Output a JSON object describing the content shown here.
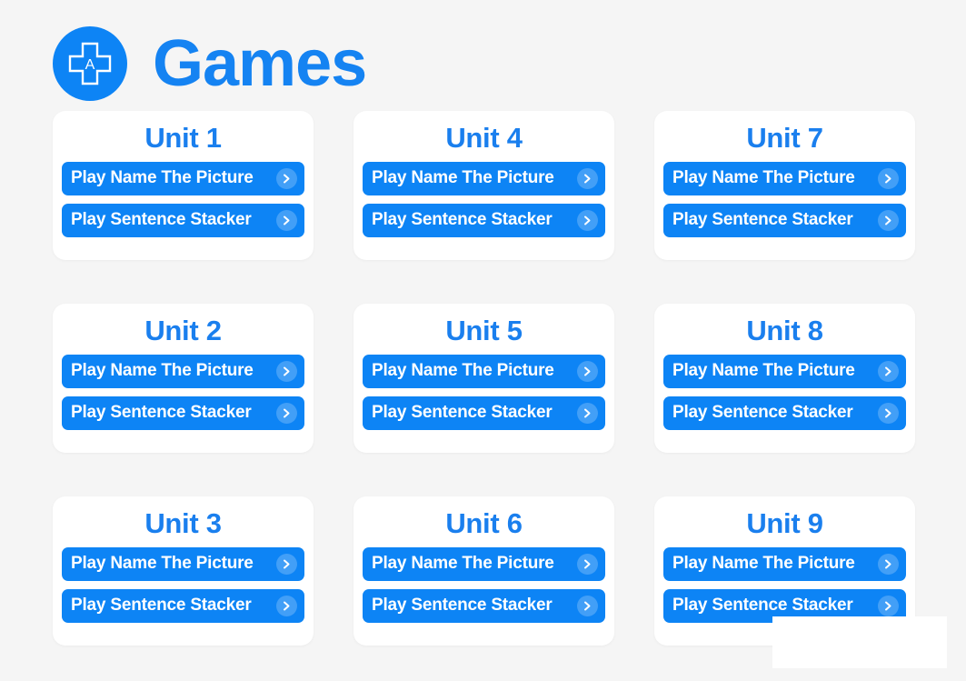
{
  "header": {
    "title": "Games",
    "icon": "dpad-a-icon",
    "icon_letter": "A",
    "accent_color": "#1583f2",
    "icon_bg_color": "#0d84f5"
  },
  "theme": {
    "page_background": "#f5f5f5",
    "card_background": "#ffffff",
    "button_blue": "#0d84f5",
    "unit_title_blue": "#1a7fee",
    "button_text": "#ffffff"
  },
  "main": {
    "buttons": {
      "name_the_picture": "Play Name The Picture",
      "sentence_stacker": "Play Sentence Stacker",
      "chevron_icon": "chevron-right-icon"
    },
    "units": [
      {
        "title": "Unit 1"
      },
      {
        "title": "Unit 4"
      },
      {
        "title": "Unit 7"
      },
      {
        "title": "Unit 2"
      },
      {
        "title": "Unit 5"
      },
      {
        "title": "Unit 8"
      },
      {
        "title": "Unit 3"
      },
      {
        "title": "Unit 6"
      },
      {
        "title": "Unit 9"
      }
    ]
  },
  "overlay": {
    "name": "blank-white-popup",
    "text": ""
  }
}
